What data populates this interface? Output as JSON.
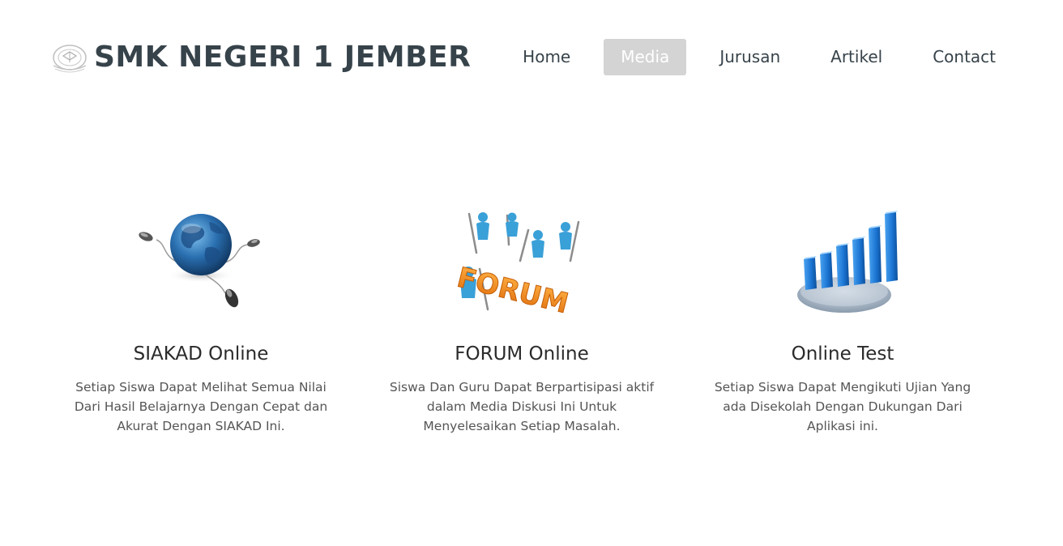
{
  "header": {
    "brand_name": "SMK NEGERI 1 JEMBER",
    "logo_icon": "school-emblem-icon"
  },
  "nav": {
    "items": [
      {
        "label": "Home",
        "active": false
      },
      {
        "label": "Media",
        "active": true
      },
      {
        "label": "Jurusan",
        "active": false
      },
      {
        "label": "Artikel",
        "active": false
      },
      {
        "label": "Contact",
        "active": false
      }
    ]
  },
  "features": [
    {
      "icon": "globe-network-icon",
      "title": "SIAKAD Online",
      "description": "Setiap Siswa Dapat Melihat Semua Nilai Dari Hasil Belajarnya Dengan Cepat dan Akurat Dengan SIAKAD Ini."
    },
    {
      "icon": "forum-people-icon",
      "title": "FORUM Online",
      "description": "Siswa Dan Guru Dapat Berpartisipasi aktif dalam Media Diskusi Ini Untuk Menyelesaikan Setiap Masalah."
    },
    {
      "icon": "bar-chart-icon",
      "title": "Online Test",
      "description": "Setiap Siswa Dapat Mengikuti Ujian Yang ada Disekolah Dengan Dukungan Dari Aplikasi ini."
    }
  ],
  "colors": {
    "brand_text": "#37434a",
    "nav_active_bg": "#d4d4d4",
    "nav_active_text": "#ffffff",
    "globe_blue": "#2a6fb0",
    "forum_orange": "#f28a1e",
    "people_blue": "#3aa0d8",
    "chart_blue": "#1a73d1"
  }
}
